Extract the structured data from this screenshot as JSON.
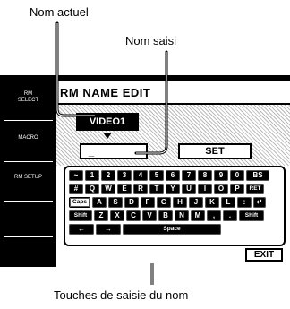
{
  "callouts": {
    "current_name": "Nom actuel",
    "entered_name": "Nom saisi",
    "name_keys": "Touches de saisie du nom"
  },
  "sidebar": {
    "items": [
      {
        "label": "RM\nSELECT"
      },
      {
        "label": "MACRO"
      },
      {
        "label": "RM SETUP"
      }
    ]
  },
  "panel": {
    "title": "RM NAME EDIT",
    "current_name": "VIDEO1",
    "input_value": "_",
    "set_label": "SET",
    "exit_label": "EXIT"
  },
  "keyboard": {
    "row1": [
      "~",
      "1",
      "2",
      "3",
      "4",
      "5",
      "6",
      "7",
      "8",
      "9",
      "0",
      "BS"
    ],
    "row2": [
      "#",
      "Q",
      "W",
      "E",
      "R",
      "T",
      "Y",
      "U",
      "I",
      "O",
      "P",
      "RET"
    ],
    "row3": [
      "Caps",
      "A",
      "S",
      "D",
      "F",
      "G",
      "H",
      "J",
      "K",
      "L",
      ":",
      "↵"
    ],
    "row4": [
      "Shift",
      "Z",
      "X",
      "C",
      "V",
      "B",
      "N",
      "M",
      ",",
      ".",
      "Shift"
    ],
    "row5": [
      "←",
      "→",
      "Space"
    ]
  }
}
